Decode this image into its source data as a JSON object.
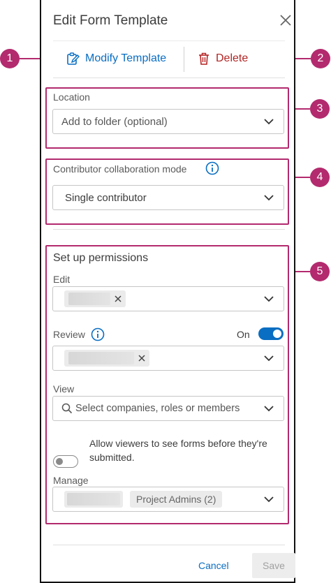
{
  "header": {
    "title": "Edit Form Template"
  },
  "actions": {
    "modify_label": "Modify Template",
    "delete_label": "Delete"
  },
  "location": {
    "label": "Location",
    "placeholder": "Add to folder (optional)"
  },
  "collab": {
    "label": "Contributor collaboration mode",
    "value": "Single contributor"
  },
  "permissions": {
    "heading": "Set up permissions",
    "edit_label": "Edit",
    "review_label": "Review",
    "review_toggle_label": "On",
    "view_label": "View",
    "view_placeholder": "Select companies, roles or members",
    "allow_viewers_text": "Allow viewers to see forms before they're submitted.",
    "manage_label": "Manage",
    "manage_chip": "Project Admins (2)"
  },
  "footer": {
    "cancel_label": "Cancel",
    "save_label": "Save"
  },
  "callouts": [
    "1",
    "2",
    "3",
    "4",
    "5"
  ],
  "colors": {
    "accent": "#0a6ec2",
    "danger": "#b32424",
    "callout": "#b32a6e"
  }
}
